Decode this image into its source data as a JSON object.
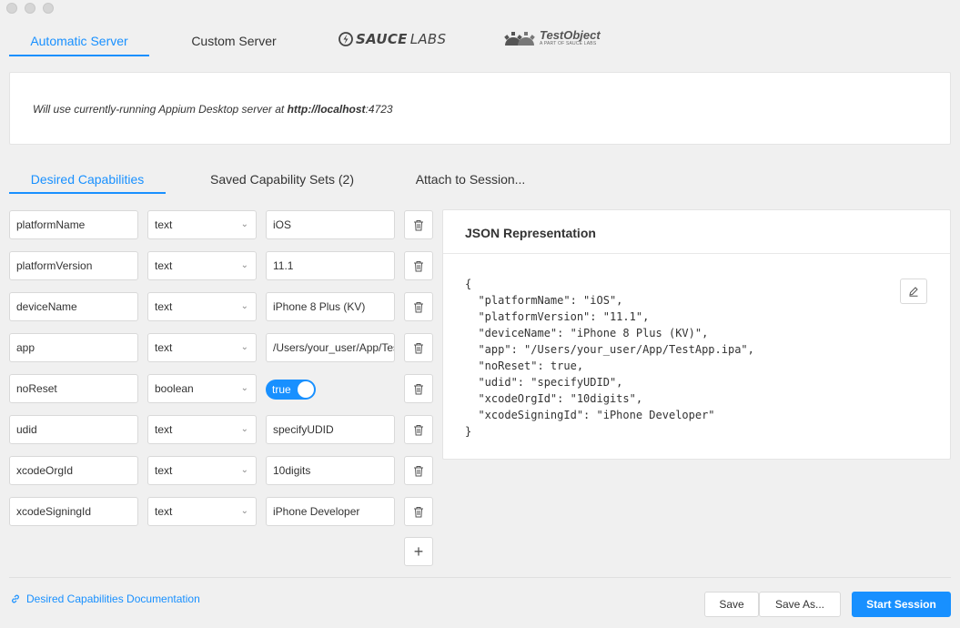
{
  "server_tabs": {
    "automatic": "Automatic Server",
    "custom": "Custom Server",
    "saucelabs_a": "SAUCE",
    "saucelabs_b": "LABS",
    "testobject_name": "TestObject",
    "testobject_sub": "A PART OF SAUCE LABS"
  },
  "server_box": {
    "message_prefix": "Will use currently-running Appium Desktop server at ",
    "url_bold": "http://localhost",
    "url_port": ":4723"
  },
  "cap_tabs": {
    "desired": "Desired Capabilities",
    "saved": "Saved Capability Sets (2)",
    "attach": "Attach to Session..."
  },
  "capabilities": [
    {
      "name": "platformName",
      "type": "text",
      "value": "iOS"
    },
    {
      "name": "platformVersion",
      "type": "text",
      "value": "11.1"
    },
    {
      "name": "deviceName",
      "type": "text",
      "value": "iPhone 8 Plus (KV)"
    },
    {
      "name": "app",
      "type": "text",
      "value": "/Users/your_user/App/TestApp.ipa"
    },
    {
      "name": "noReset",
      "type": "boolean",
      "value": "true"
    },
    {
      "name": "udid",
      "type": "text",
      "value": "specifyUDID"
    },
    {
      "name": "xcodeOrgId",
      "type": "text",
      "value": "10digits"
    },
    {
      "name": "xcodeSigningId",
      "type": "text",
      "value": "iPhone Developer"
    }
  ],
  "json_panel": {
    "title": "JSON Representation",
    "content": "{\n  \"platformName\": \"iOS\",\n  \"platformVersion\": \"11.1\",\n  \"deviceName\": \"iPhone 8 Plus (KV)\",\n  \"app\": \"/Users/your_user/App/TestApp.ipa\",\n  \"noReset\": true,\n  \"udid\": \"specifyUDID\",\n  \"xcodeOrgId\": \"10digits\",\n  \"xcodeSigningId\": \"iPhone Developer\"\n}"
  },
  "footer": {
    "doc_link": "Desired Capabilities Documentation",
    "save": "Save",
    "save_as": "Save As...",
    "start": "Start Session"
  },
  "colors": {
    "accent": "#1890ff"
  },
  "icons": {
    "trash": "trash-icon",
    "add": "plus-icon",
    "edit": "pencil-icon",
    "link": "link-icon",
    "chevron": "chevron-down-icon"
  }
}
